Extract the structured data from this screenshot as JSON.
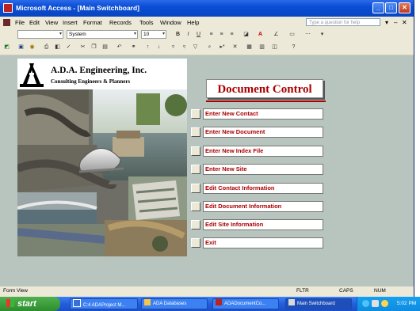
{
  "window": {
    "title": "Microsoft Access - [Main Switchboard]",
    "buttons": [
      "_",
      "□",
      "✕"
    ]
  },
  "menu": {
    "items": [
      "File",
      "Edit",
      "View",
      "Insert",
      "Format",
      "Records",
      "Tools",
      "Window",
      "Help"
    ],
    "help_placeholder": "Type a question for help"
  },
  "formatting": {
    "object": "",
    "font": "System",
    "size": "10"
  },
  "logo": {
    "company": "A.D.A. Engineering, Inc.",
    "subtitle": "Consulting Engineers & Planners"
  },
  "switchboard": {
    "title": "Document Control",
    "items": [
      "Enter New Contact",
      "Enter New Document",
      "Enter New Index File",
      "Enter New Site",
      "Edit Contact Information",
      "Edit Document Information",
      "Edit Site Information",
      "Exit"
    ]
  },
  "statusbar": {
    "view": "Form View",
    "indicators": [
      "FLTR",
      "CAPS",
      "NUM"
    ]
  },
  "taskbar": {
    "start": "start",
    "tasks": [
      "C:4 ADAProject M...",
      "ADA Databases",
      "ADADocumentCo...",
      "Main Switchboard"
    ],
    "time": "5:02 PM"
  },
  "colors": {
    "accent": "#aa0000",
    "client_bg": "#b8c4be",
    "titlebar": "#0a4ed6"
  }
}
